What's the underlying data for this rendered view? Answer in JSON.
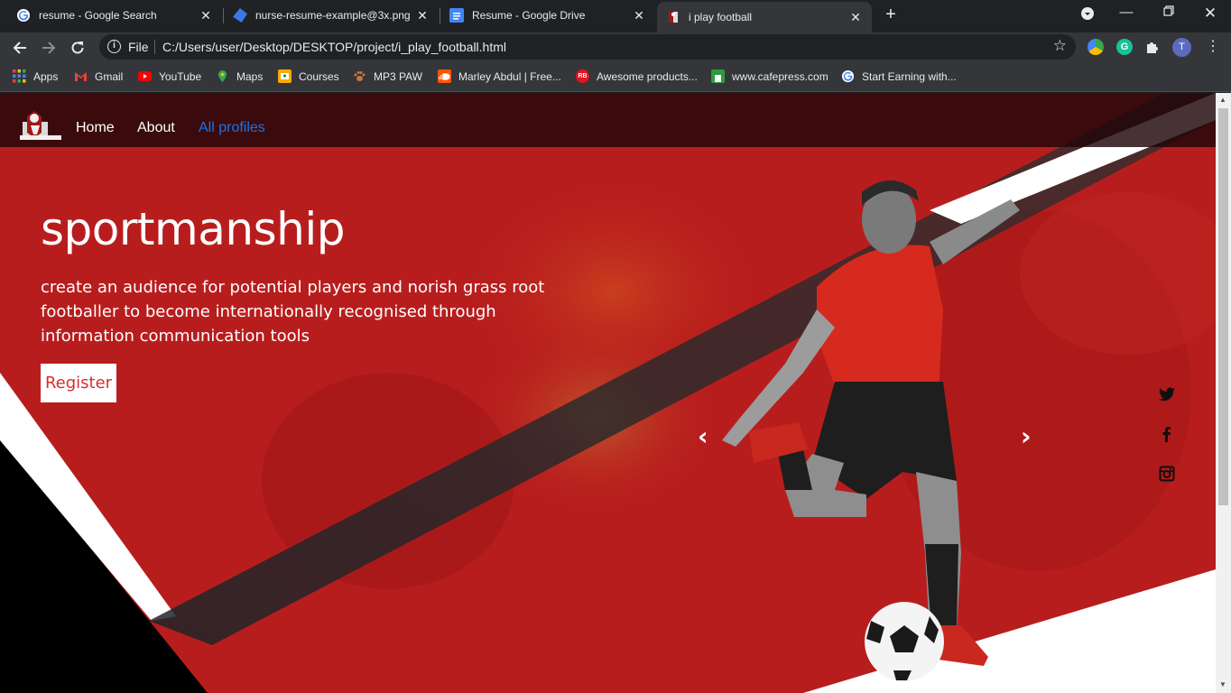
{
  "browser": {
    "tabs": [
      {
        "title": "resume - Google Search",
        "active": false
      },
      {
        "title": "nurse-resume-example@3x.png",
        "active": false
      },
      {
        "title": "Resume - Google Drive",
        "active": false
      },
      {
        "title": "i play football",
        "active": true
      }
    ],
    "address": {
      "scheme": "File",
      "url": "C:/Users/user/Desktop/DESKTOP/project/i_play_football.html"
    },
    "profile_initial": "T",
    "bookmarks": [
      {
        "label": "Apps",
        "icon": "apps-grid-icon"
      },
      {
        "label": "Gmail",
        "icon": "gmail-icon"
      },
      {
        "label": "YouTube",
        "icon": "youtube-icon"
      },
      {
        "label": "Maps",
        "icon": "maps-icon"
      },
      {
        "label": "Courses",
        "icon": "courses-icon"
      },
      {
        "label": "MP3 PAW",
        "icon": "paw-icon"
      },
      {
        "label": "Marley Abdul | Free...",
        "icon": "soundcloud-icon"
      },
      {
        "label": "Awesome products...",
        "icon": "redbubble-icon"
      },
      {
        "label": "www.cafepress.com",
        "icon": "cafepress-icon"
      },
      {
        "label": "Start Earning with...",
        "icon": "google-icon"
      }
    ]
  },
  "site": {
    "nav": {
      "home": "Home",
      "about": "About",
      "all_profiles": "All profiles"
    },
    "hero": {
      "headline": "sportmanship",
      "tagline": "create an audience for potential players and norish grass root footballer to become internationally recognised through information communication tools",
      "register_label": "Register"
    },
    "carousel": {
      "prev": "‹",
      "next": "›"
    },
    "social": [
      "twitter-icon",
      "facebook-icon",
      "instagram-icon"
    ]
  },
  "colors": {
    "hero_red": "#b81d1d",
    "nav_dark": "#1e0608",
    "active_link": "#1a73e8",
    "button_text": "#d32f2f"
  }
}
